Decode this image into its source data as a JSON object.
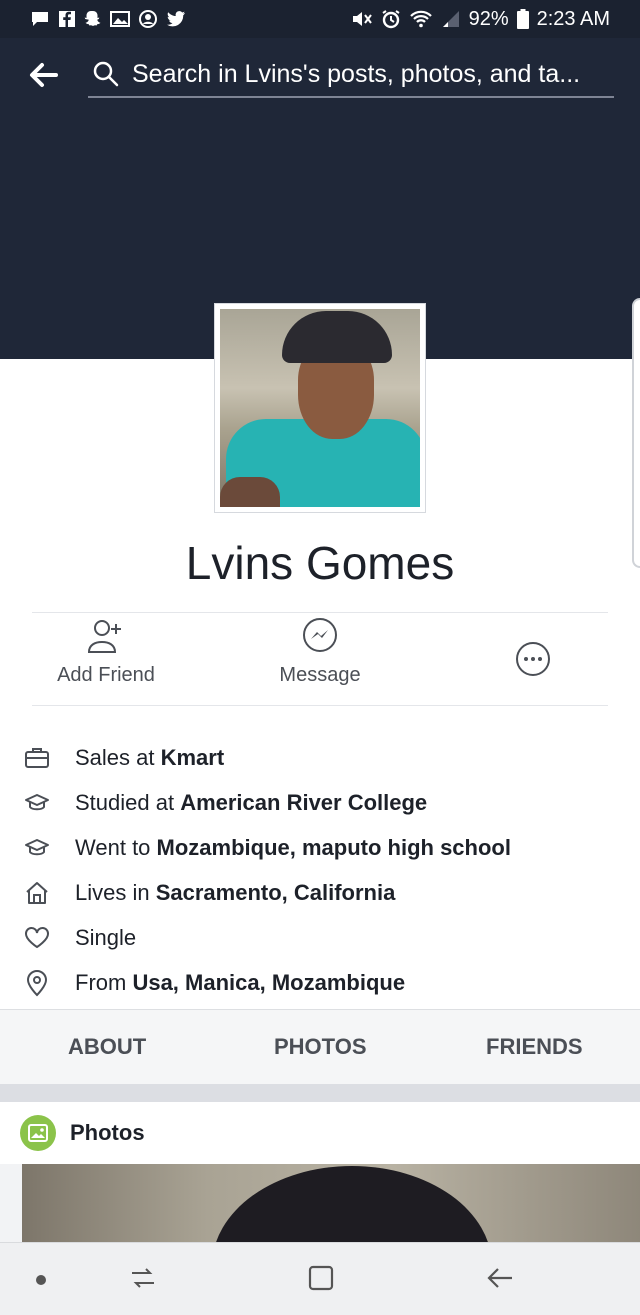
{
  "status_bar": {
    "battery": "92%",
    "time": "2:23 AM"
  },
  "search": {
    "placeholder": "Search in Lvins's posts, photos, and ta..."
  },
  "profile": {
    "name": "Lvins Gomes"
  },
  "actions": {
    "add_friend": "Add Friend",
    "message": "Message"
  },
  "info": [
    {
      "icon": "briefcase-icon",
      "prefix": "Sales at ",
      "value": "Kmart"
    },
    {
      "icon": "graduation-cap-icon",
      "prefix": "Studied at ",
      "value": "American River College"
    },
    {
      "icon": "graduation-cap-icon",
      "prefix": "Went to ",
      "value": "Mozambique, maputo high school"
    },
    {
      "icon": "home-icon",
      "prefix": "Lives in ",
      "value": "Sacramento, California"
    },
    {
      "icon": "heart-icon",
      "prefix": "Single",
      "value": ""
    },
    {
      "icon": "location-pin-icon",
      "prefix": "From ",
      "value": "Usa, Manica, Mozambique"
    }
  ],
  "tabs": {
    "about": "ABOUT",
    "photos": "PHOTOS",
    "friends": "FRIENDS"
  },
  "photos_section": {
    "title": "Photos"
  },
  "colors": {
    "header_bg": "#1f2738",
    "status_bg": "#1b2230",
    "photos_icon": "#8bc34a"
  }
}
